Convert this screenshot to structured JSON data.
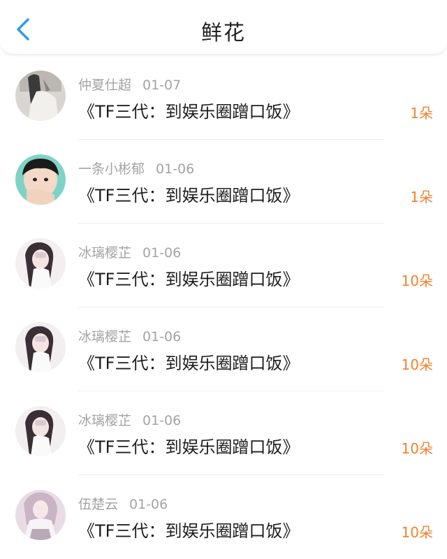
{
  "header": {
    "title": "鲜花",
    "back_icon": "chevron-left-icon",
    "accent": "#2f9be8"
  },
  "accent_count_color": "#f0822e",
  "items": [
    {
      "user": "仲夏仕超",
      "date": "01-07",
      "book": "《TF三代：到娱乐圈蹭口饭》",
      "flowers": "1朵"
    },
    {
      "user": "一条小彬郁",
      "date": "01-06",
      "book": "《TF三代：到娱乐圈蹭口饭》",
      "flowers": "1朵"
    },
    {
      "user": "冰璃樱芷",
      "date": "01-06",
      "book": "《TF三代：到娱乐圈蹭口饭》",
      "flowers": "10朵"
    },
    {
      "user": "冰璃樱芷",
      "date": "01-06",
      "book": "《TF三代：到娱乐圈蹭口饭》",
      "flowers": "10朵"
    },
    {
      "user": "冰璃樱芷",
      "date": "01-06",
      "book": "《TF三代：到娱乐圈蹭口饭》",
      "flowers": "10朵"
    },
    {
      "user": "伍楚云",
      "date": "01-06",
      "book": "《TF三代：到娱乐圈蹭口饭》",
      "flowers": "10朵"
    }
  ]
}
